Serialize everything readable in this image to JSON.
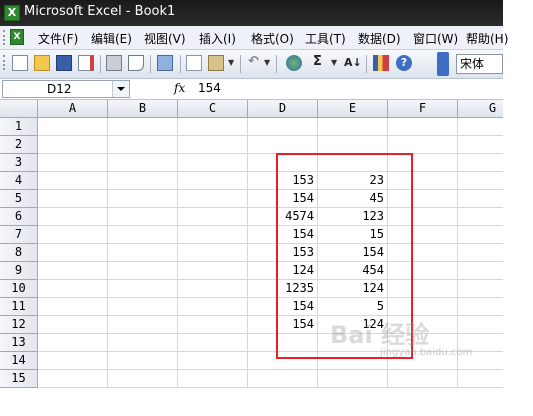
{
  "window": {
    "title": "Microsoft Excel - Book1"
  },
  "menu": {
    "items": [
      "文件(F)",
      "编辑(E)",
      "视图(V)",
      "插入(I)",
      "格式(O)",
      "工具(T)",
      "数据(D)",
      "窗口(W)",
      "帮助(H)"
    ]
  },
  "toolbar": {
    "sigma_label": "Σ",
    "sort_label": "A↓",
    "font_name": "宋体",
    "icons": [
      "new-icon",
      "open-icon",
      "save-icon",
      "permission-icon",
      "print-icon",
      "print-preview-icon",
      "research-icon",
      "copy-icon",
      "paste-icon",
      "undo-icon",
      "hyperlink-icon",
      "autosum-icon",
      "sort-ascending-icon",
      "chart-wizard-icon",
      "help-icon"
    ]
  },
  "formula_bar": {
    "name_box": "D12",
    "fx": "fx",
    "formula": "154"
  },
  "sheet": {
    "columns": [
      "A",
      "B",
      "C",
      "D",
      "E",
      "F",
      "G"
    ],
    "rows": [
      "1",
      "2",
      "3",
      "4",
      "5",
      "6",
      "7",
      "8",
      "9",
      "10",
      "11",
      "12",
      "13",
      "14",
      "15"
    ],
    "data": [
      {
        "row": 4,
        "D": "153",
        "E": "23"
      },
      {
        "row": 5,
        "D": "154",
        "E": "45"
      },
      {
        "row": 6,
        "D": "4574",
        "E": "123"
      },
      {
        "row": 7,
        "D": "154",
        "E": "15"
      },
      {
        "row": 8,
        "D": "153",
        "E": "154"
      },
      {
        "row": 9,
        "D": "124",
        "E": "454"
      },
      {
        "row": 10,
        "D": "1235",
        "E": "124"
      },
      {
        "row": 11,
        "D": "154",
        "E": "5"
      },
      {
        "row": 12,
        "D": "154",
        "E": "124"
      }
    ],
    "highlight_color": "#e8202a"
  },
  "watermark": {
    "text": "Bai 经验",
    "sub": "jingyan.baidu.com"
  }
}
